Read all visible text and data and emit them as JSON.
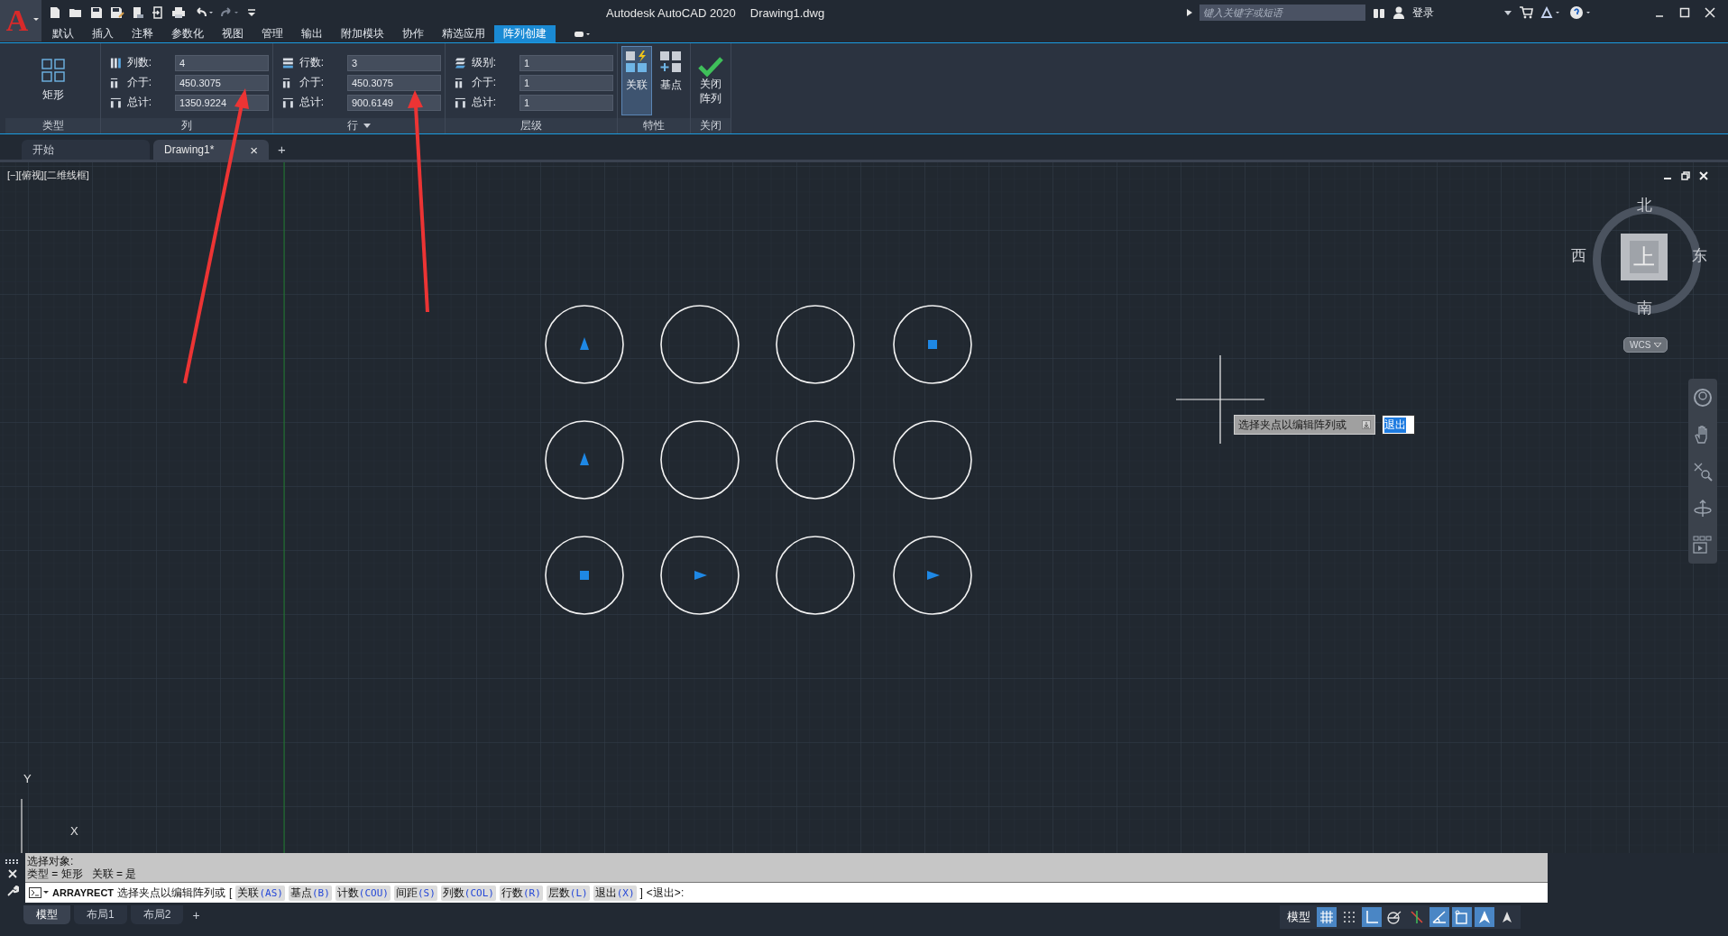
{
  "app_logo": "A",
  "window": {
    "title": "Autodesk AutoCAD 2020",
    "file": "Drawing1.dwg"
  },
  "search": {
    "placeholder": "键入关键字或短语"
  },
  "sign_in": "登录",
  "ribbon_tabs": [
    {
      "label": "默认",
      "selected": false
    },
    {
      "label": "插入",
      "selected": false
    },
    {
      "label": "注释",
      "selected": false
    },
    {
      "label": "参数化",
      "selected": false
    },
    {
      "label": "视图",
      "selected": false
    },
    {
      "label": "管理",
      "selected": false
    },
    {
      "label": "输出",
      "selected": false
    },
    {
      "label": "附加模块",
      "selected": false
    },
    {
      "label": "协作",
      "selected": false
    },
    {
      "label": "精选应用",
      "selected": false
    },
    {
      "label": "阵列创建",
      "selected": true
    }
  ],
  "ribbon": {
    "type_panel": {
      "button": "矩形",
      "title": "类型"
    },
    "field_panels": [
      {
        "title": "列",
        "dropdown": false,
        "fields": [
          {
            "kind": "count",
            "label": "列数:",
            "value": "4"
          },
          {
            "kind": "spacing",
            "label": "介于:",
            "value": "450.3075"
          },
          {
            "kind": "total",
            "label": "总计:",
            "value": "1350.9224"
          }
        ]
      },
      {
        "title": "行",
        "dropdown": true,
        "fields": [
          {
            "kind": "count",
            "label": "行数:",
            "value": "3"
          },
          {
            "kind": "spacing",
            "label": "介于:",
            "value": "450.3075"
          },
          {
            "kind": "total",
            "label": "总计:",
            "value": "900.6149"
          }
        ]
      },
      {
        "title": "层级",
        "dropdown": false,
        "fields": [
          {
            "kind": "count",
            "label": "级别:",
            "value": "1"
          },
          {
            "kind": "spacing",
            "label": "介于:",
            "value": "1"
          },
          {
            "kind": "total",
            "label": "总计:",
            "value": "1"
          }
        ]
      }
    ],
    "properties_panel": {
      "title": "特性",
      "buttons": [
        {
          "kind": "associative",
          "label": "关联",
          "selected": true
        },
        {
          "kind": "base-point",
          "label": "基点",
          "selected": false
        }
      ]
    },
    "close_panel": {
      "button": [
        "关闭",
        "阵列"
      ],
      "title": "关闭"
    }
  },
  "doc_tabs": [
    {
      "label": "开始",
      "selected": false,
      "closable": false
    },
    {
      "label": "Drawing1*",
      "selected": true,
      "closable": true
    }
  ],
  "doc_tab_close": "×",
  "new_tab": "+",
  "viewport": {
    "label": "[−][俯视][二维线框]",
    "array": [
      [
        {
          "kind": "up"
        },
        {
          "kind": "plain"
        },
        {
          "kind": "plain"
        },
        {
          "kind": "square"
        }
      ],
      [
        {
          "kind": "up"
        },
        {
          "kind": "plain"
        },
        {
          "kind": "plain"
        },
        {
          "kind": "plain"
        }
      ],
      [
        {
          "kind": "square"
        },
        {
          "kind": "right"
        },
        {
          "kind": "plain"
        },
        {
          "kind": "right"
        }
      ]
    ],
    "tooltip": {
      "text": "选择夹点以编辑阵列或",
      "input": "退出"
    },
    "viewcube": {
      "north": "北",
      "south": "南",
      "west": "西",
      "east": "东",
      "face": "上",
      "wcs": "WCS"
    },
    "ucs": {
      "x": "X",
      "y": "Y"
    }
  },
  "command": {
    "history": [
      "选择对象:",
      "类型 = 矩形   关联 = 是"
    ],
    "name": "ARRAYRECT",
    "prompt": "选择夹点以编辑阵列或",
    "open": "[",
    "close": "]",
    "default": "<退出>:",
    "options": [
      {
        "label": "关联",
        "key": "(AS)"
      },
      {
        "label": "基点",
        "key": "(B)"
      },
      {
        "label": "计数",
        "key": "(COU)"
      },
      {
        "label": "间距",
        "key": "(S)"
      },
      {
        "label": "列数",
        "key": "(COL)"
      },
      {
        "label": "行数",
        "key": "(R)"
      },
      {
        "label": "层数",
        "key": "(L)"
      },
      {
        "label": "退出",
        "key": "(X)"
      }
    ]
  },
  "layout_tabs": [
    {
      "label": "模型",
      "selected": true
    },
    {
      "label": "布局1",
      "selected": false
    },
    {
      "label": "布局2",
      "selected": false
    }
  ],
  "layout_add": "+",
  "status_bar": {
    "model": "模型",
    "toggles": [
      {
        "kind": "grid",
        "on": true
      },
      {
        "kind": "snap",
        "on": false
      },
      {
        "kind": "ortho",
        "on": true
      },
      {
        "kind": "polar",
        "on": false
      },
      {
        "kind": "osnap-track",
        "on": false
      },
      {
        "kind": "isodraft",
        "on": true
      },
      {
        "kind": "dynucs",
        "on": true
      },
      {
        "kind": "annotation",
        "on": true
      },
      {
        "kind": "autoscale",
        "on": false
      }
    ]
  }
}
